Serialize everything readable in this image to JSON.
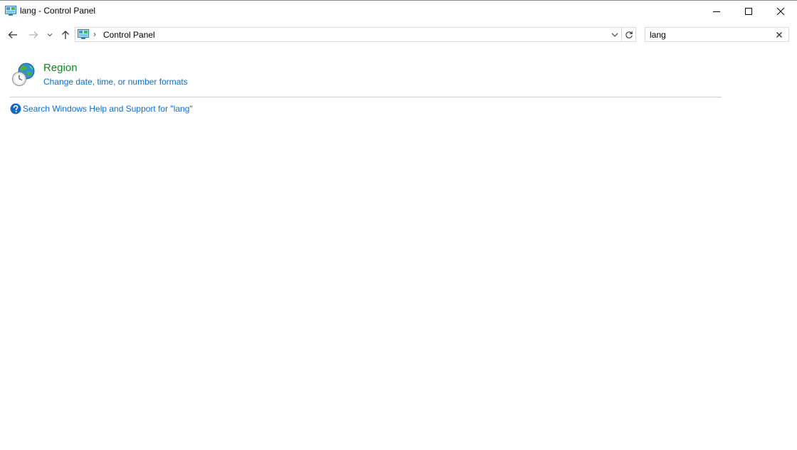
{
  "window": {
    "title": "lang - Control Panel",
    "icon": "control-panel-icon"
  },
  "controls": {
    "minimize_icon": "minimize-icon",
    "maximize_icon": "maximize-icon",
    "close_icon": "close-icon"
  },
  "nav": {
    "back_icon": "back-arrow-icon",
    "forward_icon": "forward-arrow-icon",
    "recent_icon": "chevron-down-icon",
    "up_icon": "up-arrow-icon"
  },
  "address": {
    "separator": "›",
    "crumb": "Control Panel",
    "icon": "control-panel-icon"
  },
  "search": {
    "value": "lang",
    "clear_icon": "clear-icon"
  },
  "results": [
    {
      "title": "Region",
      "task": "Change date, time, or number formats",
      "icon": "region-globe-clock-icon"
    }
  ],
  "help": {
    "link": "Search Windows Help and Support for \"lang\"",
    "icon": "help-icon"
  },
  "colors": {
    "result_title": "#0b8a1e",
    "link": "#0a6fd4",
    "divider": "#cfcfcf",
    "border": "#d9d9d9"
  }
}
